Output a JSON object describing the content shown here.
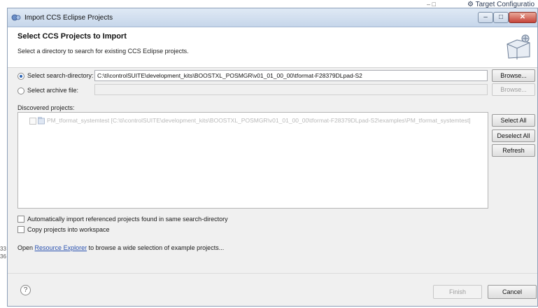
{
  "background": {
    "window_controls": "–  □",
    "target_tab": "Target Configuratio",
    "left_edge_text": [
      "33",
      "36"
    ]
  },
  "dialog": {
    "title": "Import CCS Eclipse Projects",
    "win_buttons": {
      "minimize": "–",
      "maximize": "□",
      "close": "✕"
    }
  },
  "header": {
    "title": "Select CCS Projects to Import",
    "description": "Select a directory to search for existing CCS Eclipse projects."
  },
  "source": {
    "search_directory": {
      "label": "Select search-directory:",
      "selected": true,
      "value": "C:\\ti\\controlSUITE\\development_kits\\BOOSTXL_POSMGR\\v01_01_00_00\\tformat-F28379DLpad-S2",
      "browse_label": "Browse..."
    },
    "archive_file": {
      "label": "Select archive file:",
      "selected": false,
      "value": "",
      "browse_label": "Browse..."
    }
  },
  "discovered": {
    "label": "Discovered projects:",
    "projects": [
      {
        "name": "PM_tformat_systemtest",
        "path": "[C:\\ti\\controlSUITE\\development_kits\\BOOSTXL_POSMGR\\v01_01_00_00\\tformat-F28379DLpad-S2\\examples\\PM_tformat_systemtest]",
        "checked": false,
        "enabled": false
      }
    ],
    "buttons": {
      "select_all": "Select All",
      "deselect_all": "Deselect All",
      "refresh": "Refresh"
    }
  },
  "options": {
    "auto_import": "Automatically import referenced projects found in same search-directory",
    "copy_into_workspace": "Copy projects into workspace"
  },
  "resource_line": {
    "prefix": "Open",
    "link": "Resource Explorer",
    "suffix": "to browse a wide selection of example projects..."
  },
  "footer": {
    "help": "?",
    "finish": "Finish",
    "cancel": "Cancel"
  },
  "colors": {
    "link": "#2a52b0",
    "titlebar": "#c6d6ea",
    "close_button": "#c6443a",
    "disabled_text": "#b9b9b9"
  }
}
